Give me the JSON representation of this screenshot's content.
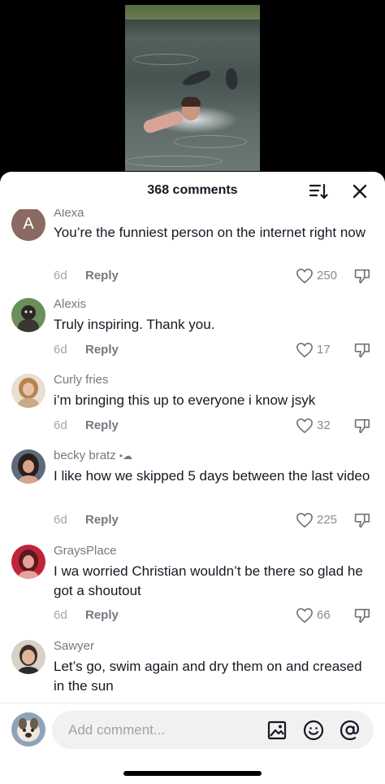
{
  "video": {
    "icon": "video-thumbnail"
  },
  "header": {
    "comments_count": "368 comments",
    "sort_icon": "sort-icon",
    "close_icon": "close-icon"
  },
  "comments": [
    {
      "avatar": "A",
      "username": "Alexa",
      "text": "You’re the funniest person on the internet right now",
      "age": "6d",
      "reply": "Reply",
      "likes": "250"
    },
    {
      "username": "Alexis",
      "text": "Truly inspiring. Thank you.",
      "age": "6d",
      "reply": "Reply",
      "likes": "17"
    },
    {
      "username": "Curly fries",
      "text": "i’m bringing this up to everyone i know jsyk",
      "age": "6d",
      "reply": "Reply",
      "likes": "32"
    },
    {
      "username": "becky bratz",
      "username_emoji": "•☁︎",
      "text": "I like how we skipped 5 days between the last video",
      "age": "6d",
      "reply": "Reply",
      "likes": "225"
    },
    {
      "username": "GraysPlace",
      "text": "I wa worried Christian wouldn’t be there so glad he got a shoutout",
      "age": "6d",
      "reply": "Reply",
      "likes": "66"
    },
    {
      "username": "Sawyer",
      "text": "Let’s go, swim again and dry them on and creased in the sun"
    }
  ],
  "composer": {
    "placeholder": "Add comment...",
    "icons": [
      "image-icon",
      "emoji-icon",
      "mention-icon"
    ]
  },
  "colors": {
    "text": "#161823",
    "muted": "#767880",
    "light": "#a5a6ab"
  }
}
